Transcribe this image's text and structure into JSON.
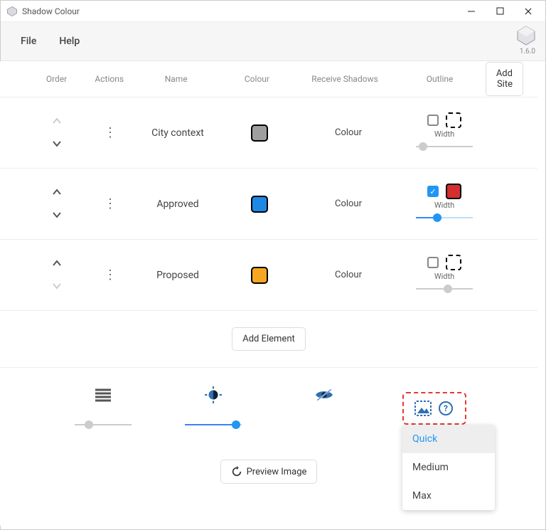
{
  "window": {
    "title": "Shadow Colour"
  },
  "menus": {
    "file": "File",
    "help": "Help"
  },
  "version": "1.6.0",
  "headers": {
    "order": "Order",
    "actions": "Actions",
    "name": "Name",
    "colour": "Colour",
    "receive": "Receive Shadows",
    "outline": "Outline",
    "addSite": "Add Site"
  },
  "rows": [
    {
      "name": "City context",
      "colour": "#9e9e9e",
      "receive_mode": "Colour",
      "outline_checked": false,
      "outline_colour": "",
      "upDim": true,
      "downDim": false,
      "widthLabel": "Width",
      "sliderPos": 10,
      "sliderActive": false
    },
    {
      "name": "Approved",
      "colour": "#1e88e5",
      "receive_mode": "Colour",
      "outline_checked": true,
      "outline_colour": "#d32f2f",
      "upDim": false,
      "downDim": false,
      "widthLabel": "Width",
      "sliderPos": 30,
      "sliderActive": true
    },
    {
      "name": "Proposed",
      "colour": "#f5a623",
      "receive_mode": "Colour",
      "outline_checked": false,
      "outline_colour": "",
      "upDim": false,
      "downDim": true,
      "widthLabel": "Width",
      "sliderPos": 45,
      "sliderActive": false
    }
  ],
  "buttons": {
    "addElement": "Add Element",
    "previewImage": "Preview Image"
  },
  "qualityMenu": {
    "options": [
      "Quick",
      "Medium",
      "Max"
    ],
    "selected": "Quick"
  },
  "bottomSliders": {
    "lines": 20,
    "brightness": 88
  }
}
